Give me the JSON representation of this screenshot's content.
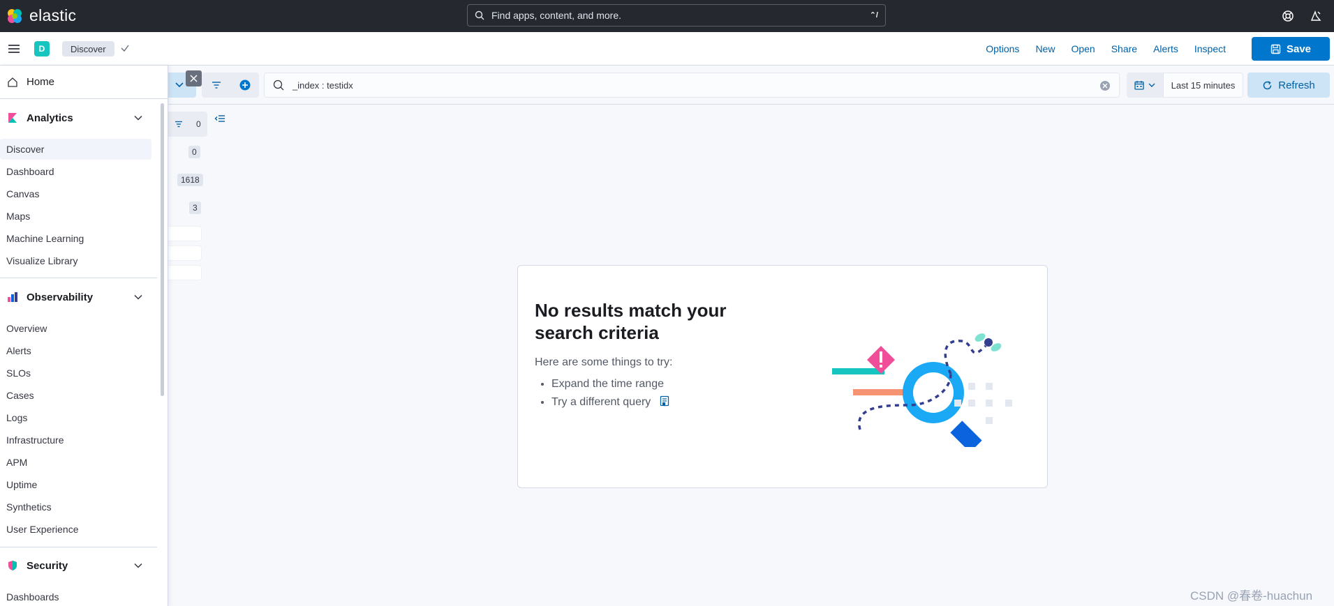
{
  "header": {
    "brand": "elastic",
    "search_placeholder": "Find apps, content, and more.",
    "search_shortcut": "⌃/"
  },
  "breadcrumb": {
    "space_initial": "D",
    "current": "Discover"
  },
  "top_nav": {
    "options": "Options",
    "new": "New",
    "open": "Open",
    "share": "Share",
    "alerts": "Alerts",
    "inspect": "Inspect",
    "save": "Save"
  },
  "query_bar": {
    "query": "_index : testidx",
    "date_range": "Last 15 minutes",
    "refresh": "Refresh"
  },
  "field_list": {
    "filter_count": "0",
    "counts": [
      "0",
      "1618",
      "3"
    ]
  },
  "empty_state": {
    "title": "No results match your search criteria",
    "subtitle": "Here are some things to try:",
    "suggestions": [
      "Expand the time range",
      "Try a different query"
    ]
  },
  "sidenav": {
    "home": "Home",
    "analytics": {
      "label": "Analytics",
      "items": [
        "Discover",
        "Dashboard",
        "Canvas",
        "Maps",
        "Machine Learning",
        "Visualize Library"
      ]
    },
    "observability": {
      "label": "Observability",
      "items": [
        "Overview",
        "Alerts",
        "SLOs",
        "Cases",
        "Logs",
        "Infrastructure",
        "APM",
        "Uptime",
        "Synthetics",
        "User Experience"
      ]
    },
    "security": {
      "label": "Security",
      "items": [
        "Dashboards"
      ]
    }
  },
  "watermark": "CSDN @春卷-huachun",
  "colors": {
    "header_bg": "#25282f",
    "primary": "#0077cc",
    "link": "#0061a6",
    "space_badge": "#16c5c0"
  }
}
